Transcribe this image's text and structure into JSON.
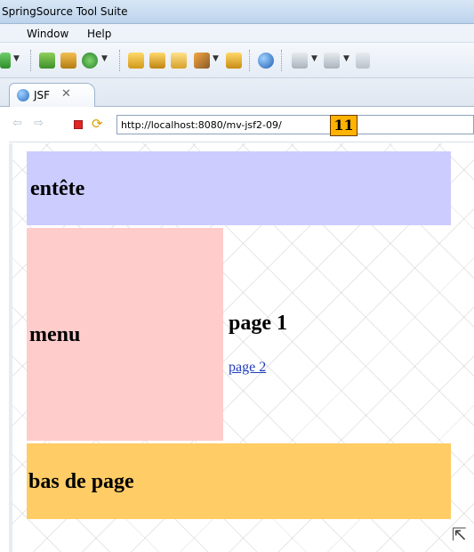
{
  "window": {
    "title": "SpringSource Tool Suite"
  },
  "menubar": {
    "items": [
      {
        "label": "Window"
      },
      {
        "label": "Help"
      }
    ]
  },
  "toolbar": {
    "icons": [
      "run-icon",
      "new-class-icon",
      "new-package-icon",
      "new-server-icon",
      "open-folder-icon",
      "open-project-icon",
      "open-file-icon",
      "wand-icon",
      "folder-icon",
      "browser-icon",
      "next-annotation-icon",
      "prev-annotation-icon",
      "back-icon"
    ]
  },
  "editor": {
    "tab": {
      "label": "JSF",
      "close_glyph": "✕"
    }
  },
  "browser": {
    "back_glyph": "⇦",
    "forward_glyph": "⇨",
    "url": "http://localhost:8080/mv-jsf2-09/",
    "badge": "11"
  },
  "page": {
    "header": "entête",
    "menu": "menu",
    "content_title": "page 1",
    "content_link": "page 2",
    "footer": "bas de page"
  },
  "colors": {
    "header_bg": "#ccccff",
    "menu_bg": "#ffcccc",
    "footer_bg": "#ffcc66",
    "badge_bg": "#ffb300",
    "link": "#1f3dbf"
  }
}
